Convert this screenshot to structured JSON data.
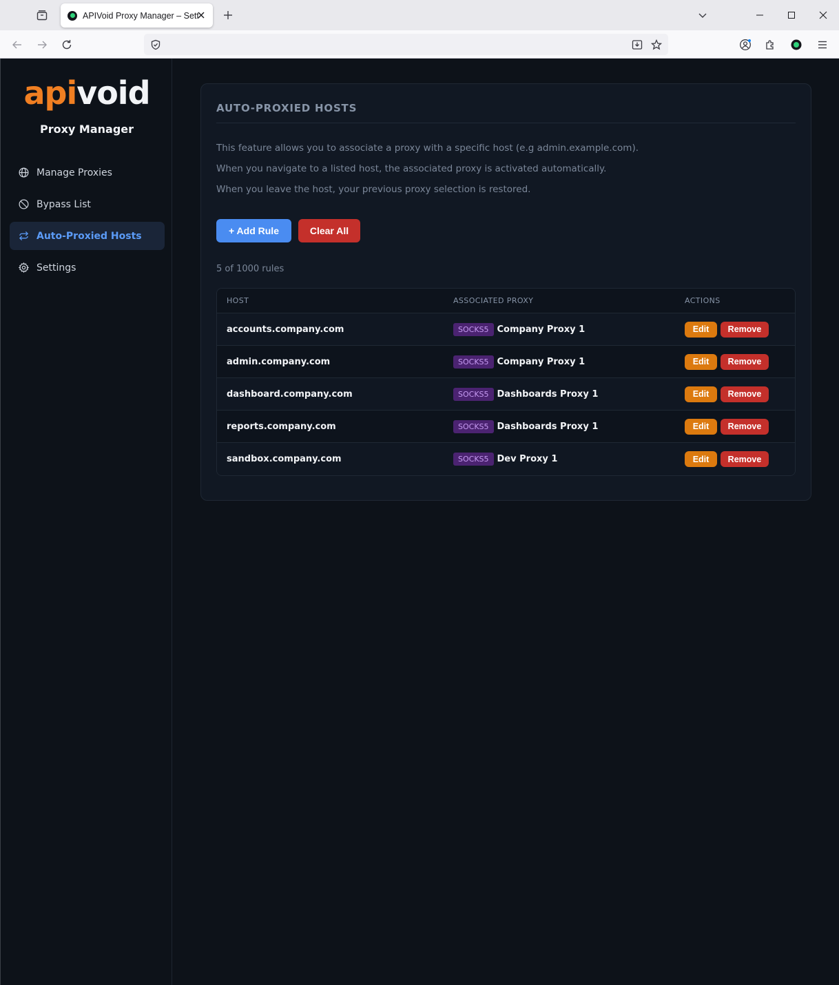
{
  "browser": {
    "tab_title": "APIVoid Proxy Manager – Settings"
  },
  "app": {
    "logo_api": "api",
    "logo_void": "void",
    "subtitle": "Proxy Manager",
    "accent": "#5b9bf7"
  },
  "sidebar": {
    "items": [
      {
        "label": "Manage Proxies",
        "icon": "globe-icon",
        "active": false
      },
      {
        "label": "Bypass List",
        "icon": "ban-icon",
        "active": false
      },
      {
        "label": "Auto-Proxied Hosts",
        "icon": "sync-arrows-icon",
        "active": true
      },
      {
        "label": "Settings",
        "icon": "gear-icon",
        "active": false
      }
    ]
  },
  "panel": {
    "title": "AUTO-PROXIED HOSTS",
    "description": [
      "This feature allows you to associate a proxy with a specific host (e.g admin.example.com).",
      "When you navigate to a listed host, the associated proxy is activated automatically.",
      "When you leave the host, your previous proxy selection is restored."
    ],
    "add_rule_label": "+ Add Rule",
    "clear_all_label": "Clear All",
    "rule_count": "5 of 1000 rules"
  },
  "table": {
    "headers": {
      "host": "HOST",
      "proxy": "ASSOCIATED PROXY",
      "actions": "ACTIONS"
    },
    "edit_label": "Edit",
    "remove_label": "Remove",
    "rows": [
      {
        "host": "accounts.company.com",
        "type": "SOCKS5",
        "proxy": "Company Proxy 1"
      },
      {
        "host": "admin.company.com",
        "type": "SOCKS5",
        "proxy": "Company Proxy 1"
      },
      {
        "host": "dashboard.company.com",
        "type": "SOCKS5",
        "proxy": "Dashboards Proxy 1"
      },
      {
        "host": "reports.company.com",
        "type": "SOCKS5",
        "proxy": "Dashboards Proxy 1"
      },
      {
        "host": "sandbox.company.com",
        "type": "SOCKS5",
        "proxy": "Dev Proxy 1"
      }
    ]
  }
}
